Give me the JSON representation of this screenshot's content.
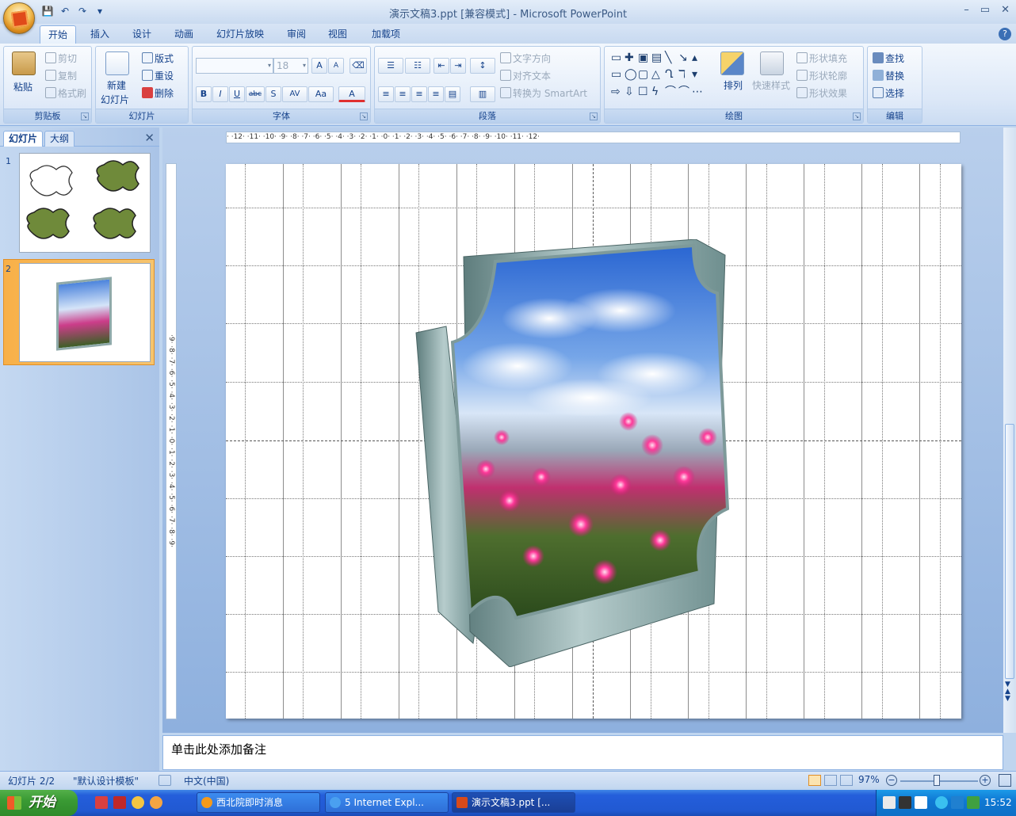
{
  "window": {
    "title": "演示文稿3.ppt [兼容模式] - Microsoft PowerPoint",
    "controls": {
      "minimize": "–",
      "restore": "▭",
      "close": "✕"
    }
  },
  "quick_access": {
    "save": "💾",
    "undo": "↶",
    "redo": "↷",
    "more": "▾"
  },
  "tabs": [
    "开始",
    "插入",
    "设计",
    "动画",
    "幻灯片放映",
    "审阅",
    "视图",
    "加载项"
  ],
  "active_tab": "开始",
  "help_label": "?",
  "ribbon": {
    "clipboard": {
      "label": "剪贴板",
      "paste": "粘贴",
      "cut": "剪切",
      "copy": "复制",
      "format_painter": "格式刷"
    },
    "slides": {
      "label": "幻灯片",
      "new_slide_line1": "新建",
      "new_slide_line2": "幻灯片",
      "layout": "版式",
      "reset": "重设",
      "delete": "删除"
    },
    "font": {
      "label": "字体",
      "font_name": "",
      "font_size": "18",
      "buttons": [
        "B",
        "I",
        "U",
        "abc",
        "S",
        "AV",
        "Aa",
        "A"
      ],
      "grow": "A",
      "shrink": "A"
    },
    "paragraph": {
      "label": "段落",
      "text_direction": "文字方向",
      "align_text": "对齐文本",
      "convert_smartart": "转换为 SmartArt"
    },
    "drawing": {
      "label": "绘图",
      "shapes": [
        "▭",
        "✚",
        "▣",
        "▤",
        "╲",
        "↘",
        "▴",
        "▭",
        "◯",
        "▢",
        "△",
        "Ղ",
        "ℸ",
        "▾",
        "⇨",
        "⇩",
        "☐",
        "ϟ",
        "⌒",
        "⌒",
        "⋯"
      ],
      "arrange": "排列",
      "quick_styles": "快速样式",
      "shape_fill": "形状填充",
      "shape_outline": "形状轮廓",
      "shape_effects": "形状效果"
    },
    "editing": {
      "label": "编辑",
      "find": "查找",
      "replace": "替换",
      "select": "选择"
    }
  },
  "left_pane": {
    "tabs": [
      "幻灯片",
      "大纲"
    ],
    "close": "✕",
    "slides": [
      {
        "number": "1"
      },
      {
        "number": "2"
      }
    ]
  },
  "rulers": {
    "horizontal": "· ·12· ·11· ·10· ·9· ·8· ·7· ·6· ·5· ·4· ·3· ·2· ·1· ·0· ·1· ·2· ·3· ·4· ·5· ·6· ·7· ·8· ·9· ·10· ·11· ·12·",
    "vertical": "·9· ·8· ·7· ·6· ·5· ·4· ·3· ·2· ·1· ·0· ·1· ·2· ·3· ·4· ·5· ·6· ·7· ·8· ·9·"
  },
  "notes_placeholder": "单击此处添加备注",
  "status": {
    "slide_position": "幻灯片 2/2",
    "theme": "\"默认设计模板\"",
    "language": "中文(中国)",
    "zoom": "97%"
  },
  "taskbar": {
    "start": "开始",
    "items": [
      "西北院即时消息",
      "5 Internet Expl...",
      "演示文稿3.ppt [..."
    ],
    "clock": "15:52"
  },
  "colors": {
    "ribbon_text": "#15428b",
    "slide_bg": "#ffffff",
    "taskbar": "#245edb",
    "selected_thumb": "#f8b048"
  }
}
